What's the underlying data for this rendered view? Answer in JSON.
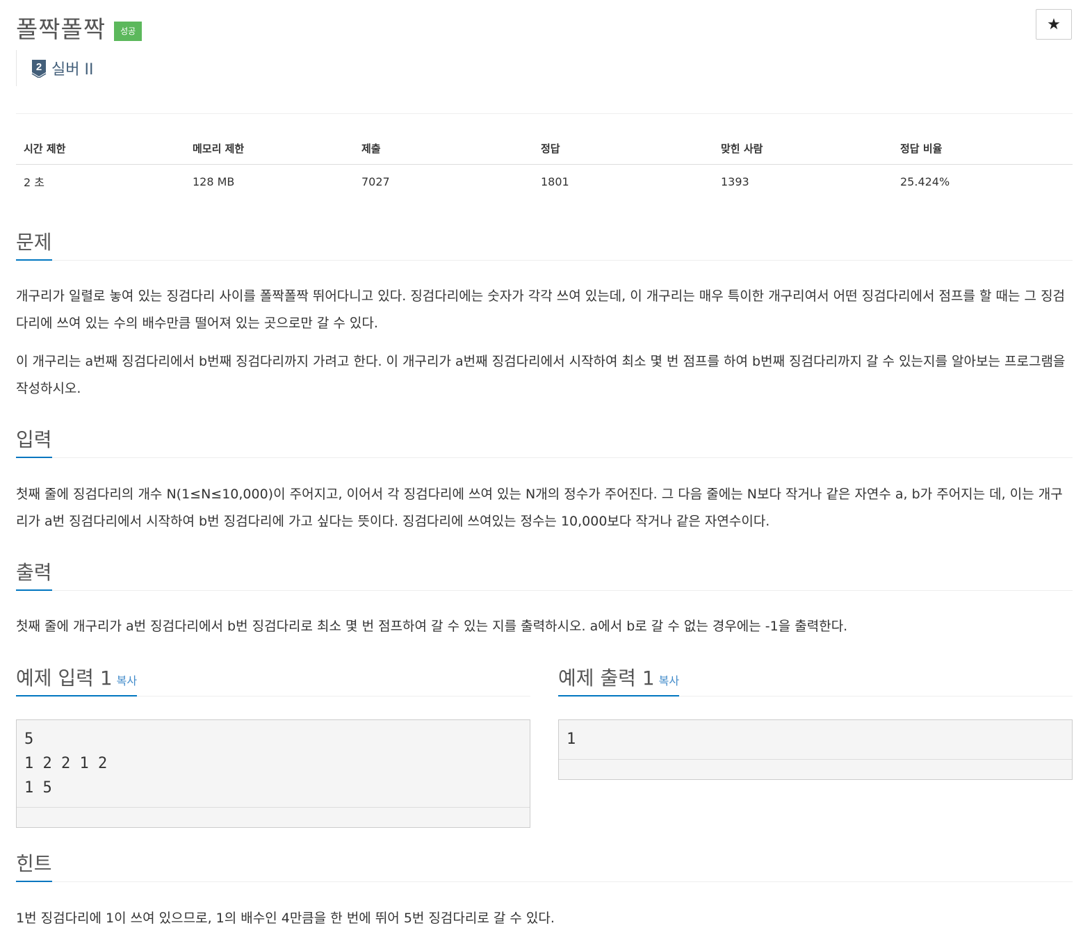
{
  "problem": {
    "title": "폴짝폴짝",
    "status_badge": "성공",
    "star_symbol": "★",
    "tier": {
      "number": "2",
      "label": "실버 II",
      "color": "#435f7a"
    }
  },
  "info": {
    "headers": [
      "시간 제한",
      "메모리 제한",
      "제출",
      "정답",
      "맞힌 사람",
      "정답 비율"
    ],
    "values": [
      "2 초",
      "128 MB",
      "7027",
      "1801",
      "1393",
      "25.424%"
    ]
  },
  "sections": {
    "problem": {
      "heading": "문제",
      "paragraphs": [
        "개구리가 일렬로 놓여 있는 징검다리 사이를 폴짝폴짝 뛰어다니고 있다. 징검다리에는 숫자가 각각 쓰여 있는데, 이 개구리는 매우 특이한 개구리여서 어떤 징검다리에서 점프를 할 때는 그 징검다리에 쓰여 있는 수의 배수만큼 떨어져 있는 곳으로만 갈 수 있다.",
        "이 개구리는 a번째 징검다리에서 b번째 징검다리까지 가려고 한다. 이 개구리가 a번째 징검다리에서 시작하여 최소 몇 번 점프를 하여 b번째 징검다리까지 갈 수 있는지를 알아보는 프로그램을 작성하시오."
      ]
    },
    "input": {
      "heading": "입력",
      "text": "첫째 줄에 징검다리의 개수 N(1≤N≤10,000)이 주어지고, 이어서 각 징검다리에 쓰여 있는 N개의 정수가 주어진다. 그 다음 줄에는 N보다 작거나 같은 자연수 a, b가 주어지는 데, 이는 개구리가 a번 징검다리에서 시작하여 b번 징검다리에 가고 싶다는 뜻이다. 징검다리에 쓰여있는 정수는 10,000보다 작거나 같은 자연수이다."
    },
    "output": {
      "heading": "출력",
      "text": "첫째 줄에 개구리가 a번 징검다리에서 b번 징검다리로 최소 몇 번 점프하여 갈 수 있는 지를 출력하시오. a에서 b로 갈 수 없는 경우에는 -1을 출력한다."
    },
    "sample_input": {
      "heading": "예제 입력 1",
      "copy_label": "복사",
      "content": "5\n1 2 2 1 2\n1 5"
    },
    "sample_output": {
      "heading": "예제 출력 1",
      "copy_label": "복사",
      "content": "1"
    },
    "hint": {
      "heading": "힌트",
      "text": "1번 징검다리에 1이 쓰여 있으므로, 1의 배수인 4만큼을 한 번에 뛰어 5번 징검다리로 갈 수 있다."
    }
  },
  "colors": {
    "success_badge": "#5cb85c",
    "headline_underline": "#0076c0",
    "link": "#428bca"
  }
}
